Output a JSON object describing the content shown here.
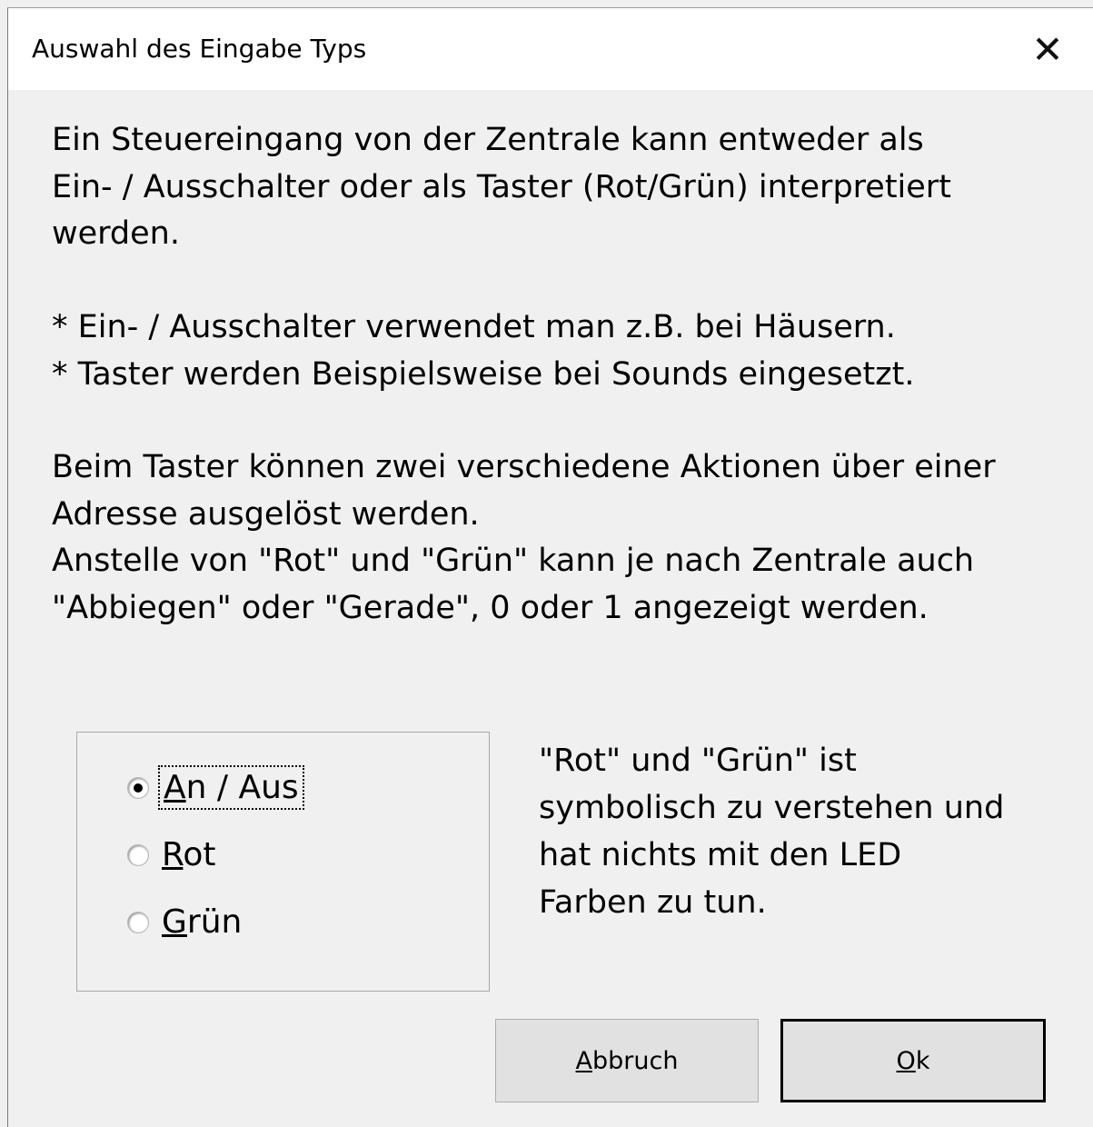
{
  "window": {
    "title": "Auswahl des Eingabe Typs",
    "close_glyph": "✕"
  },
  "text": {
    "para1": "Ein Steuereingang von der Zentrale kann entweder als\nEin- / Ausschalter oder als Taster (Rot/Grün) interpretiert\nwerden.",
    "para2": "* Ein- / Ausschalter verwendet man z.B. bei Häusern.\n* Taster werden Beispielsweise bei Sounds eingesetzt.",
    "para3": "Beim Taster können zwei verschiedene Aktionen über einer\nAdresse ausgelöst werden.\nAnstelle von \"Rot\" und \"Grün\" kann je nach Zentrale auch\n\"Abbiegen\" oder \"Gerade\", 0 oder 1 angezeigt werden."
  },
  "options": [
    {
      "mnemonic": "A",
      "rest": "n / Aus",
      "checked": true
    },
    {
      "mnemonic": "R",
      "rest": "ot",
      "checked": false
    },
    {
      "mnemonic": "G",
      "rest": "rün",
      "checked": false
    }
  ],
  "note": "\"Rot\" und \"Grün\" ist\nsymbolisch zu verstehen und\nhat nichts mit den LED\nFarben zu tun.",
  "buttons": {
    "cancel": {
      "mnemonic": "A",
      "rest": "bbruch"
    },
    "ok": {
      "mnemonic": "O",
      "rest": "k"
    }
  }
}
